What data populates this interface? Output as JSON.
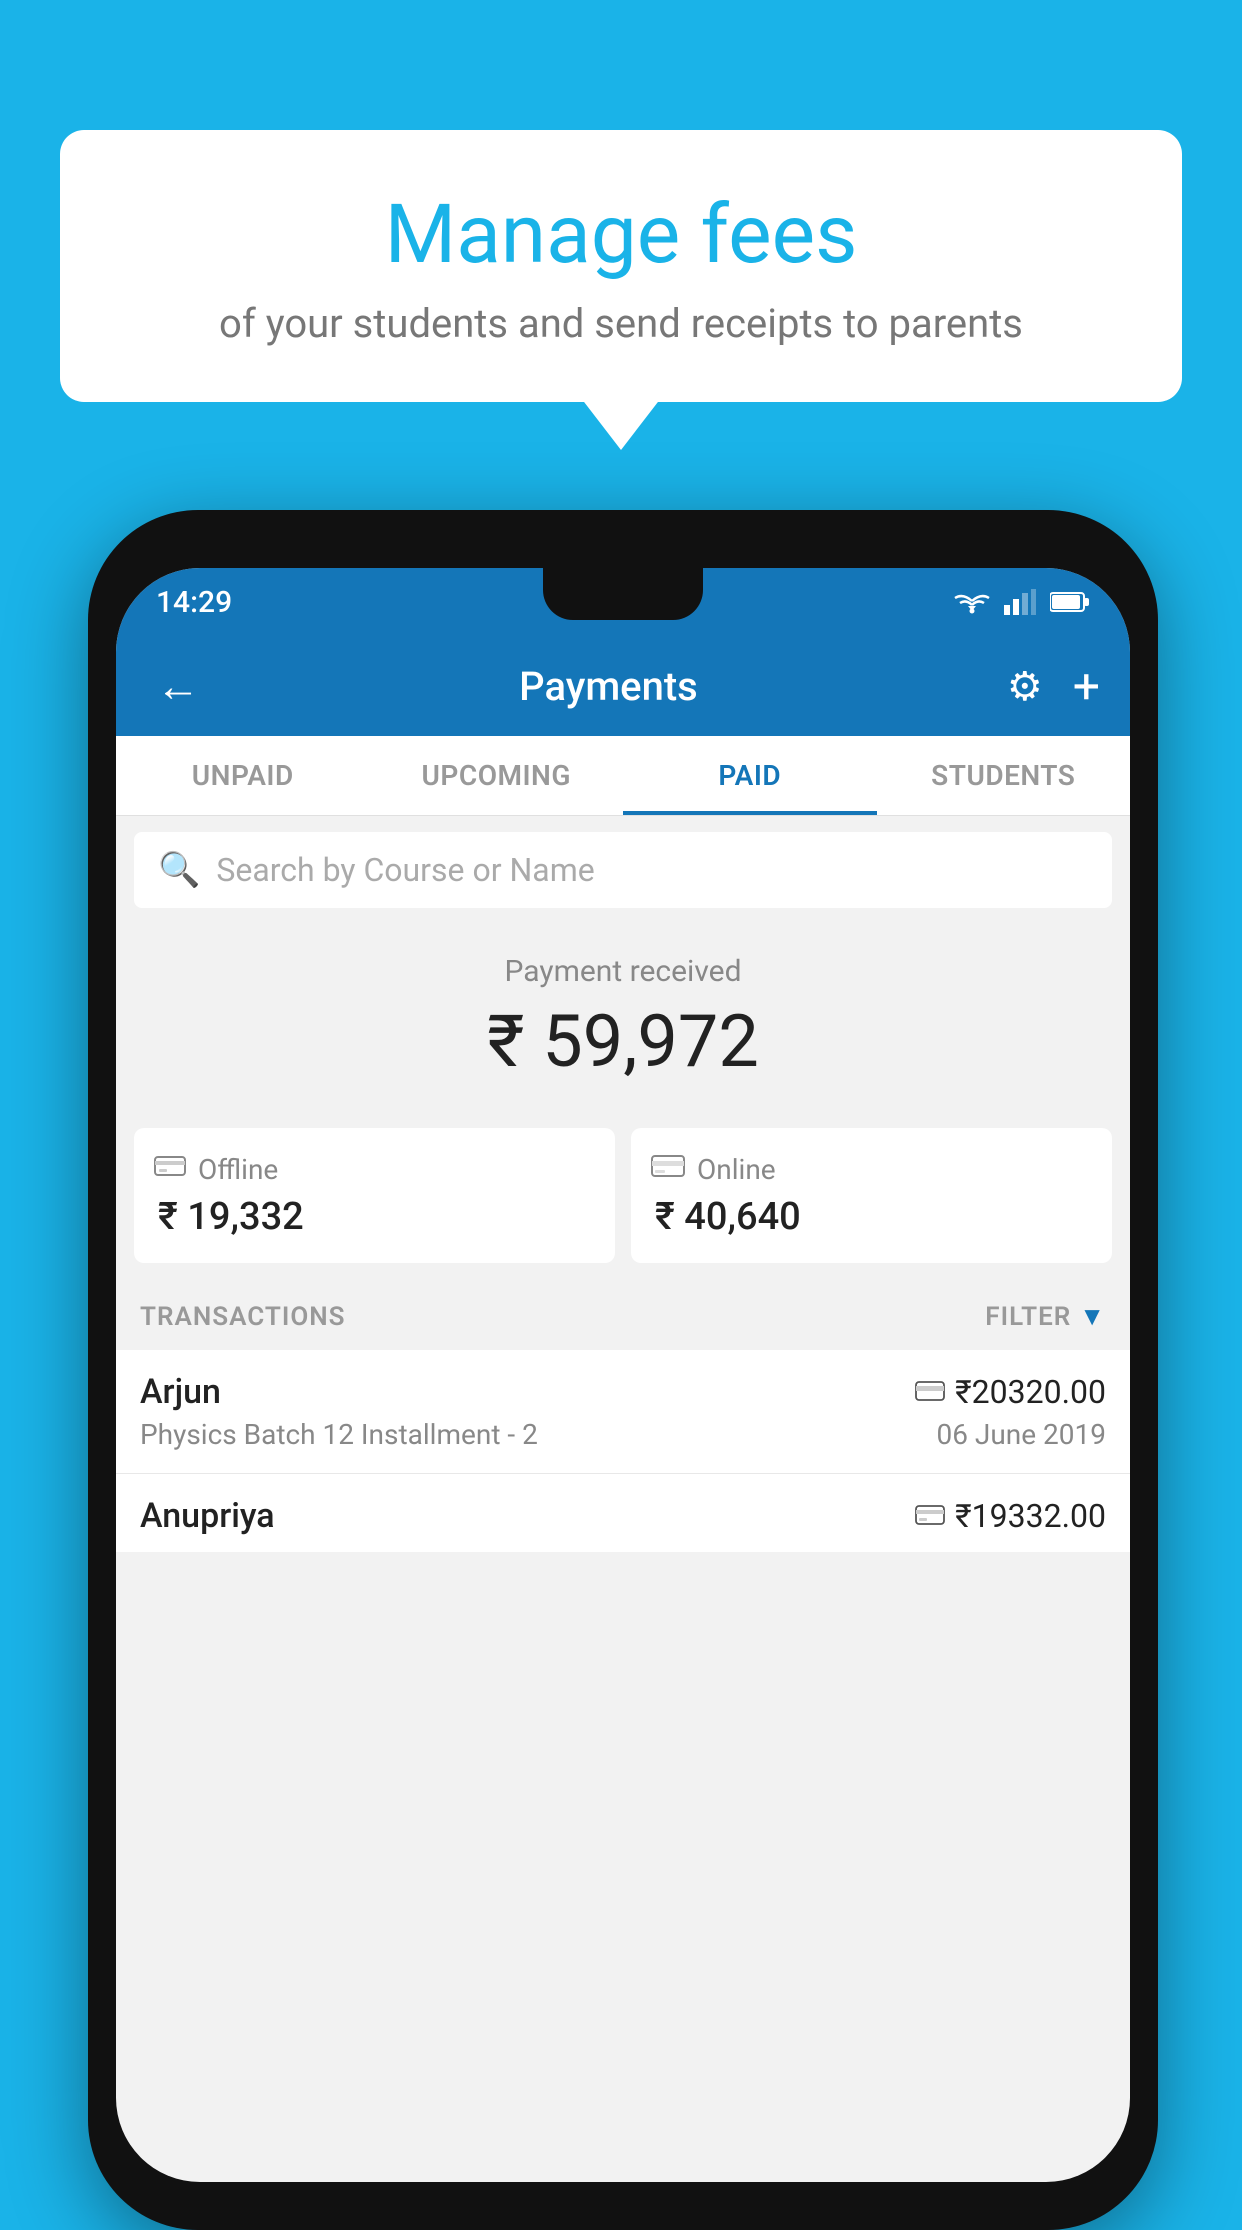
{
  "page": {
    "background_color": "#1ab3e8"
  },
  "speech_bubble": {
    "title": "Manage fees",
    "subtitle": "of your students and send receipts to parents"
  },
  "status_bar": {
    "time": "14:29"
  },
  "app_bar": {
    "title": "Payments",
    "back_label": "←",
    "settings_label": "⚙",
    "add_label": "+"
  },
  "tabs": [
    {
      "id": "unpaid",
      "label": "UNPAID",
      "active": false
    },
    {
      "id": "upcoming",
      "label": "UPCOMING",
      "active": false
    },
    {
      "id": "paid",
      "label": "PAID",
      "active": true
    },
    {
      "id": "students",
      "label": "STUDENTS",
      "active": false
    }
  ],
  "search": {
    "placeholder": "Search by Course or Name"
  },
  "payment_summary": {
    "label": "Payment received",
    "total": "₹ 59,972",
    "offline": {
      "label": "Offline",
      "amount": "₹ 19,332"
    },
    "online": {
      "label": "Online",
      "amount": "₹ 40,640"
    }
  },
  "transactions_section": {
    "label": "TRANSACTIONS",
    "filter_label": "FILTER"
  },
  "transactions": [
    {
      "name": "Arjun",
      "course": "Physics Batch 12 Installment - 2",
      "amount": "₹20320.00",
      "date": "06 June 2019",
      "payment_type": "card"
    },
    {
      "name": "Anupriya",
      "course": "",
      "amount": "₹19332.00",
      "date": "",
      "payment_type": "cash"
    }
  ]
}
